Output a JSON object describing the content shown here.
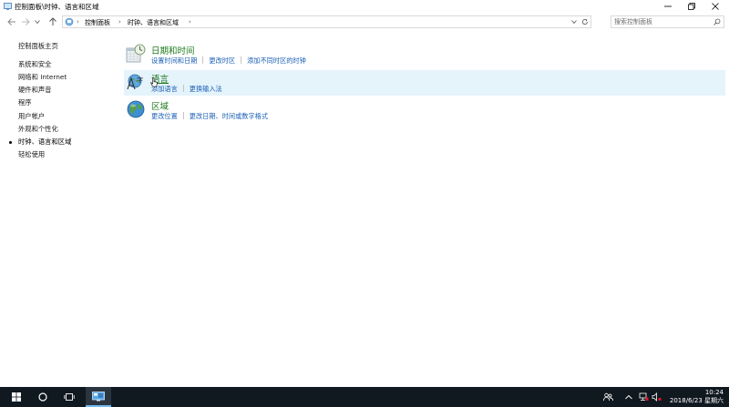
{
  "window": {
    "title": "控制面板\\时钟、语言和区域"
  },
  "address": {
    "crumbs": [
      "控制面板",
      "时钟、语言和区域"
    ],
    "search_placeholder": "搜索控制面板"
  },
  "sidebar": {
    "items": [
      {
        "label": "控制面板主页"
      },
      {
        "label": "系统和安全"
      },
      {
        "label": "网络和 Internet"
      },
      {
        "label": "硬件和声音"
      },
      {
        "label": "程序"
      },
      {
        "label": "用户帐户"
      },
      {
        "label": "外观和个性化"
      },
      {
        "label": "时钟、语言和区域",
        "current": true
      },
      {
        "label": "轻松使用"
      }
    ]
  },
  "categories": [
    {
      "title": "日期和时间",
      "icon": "date-time-icon",
      "links": [
        "设置时间和日期",
        "更改时区",
        "添加不同时区的时钟"
      ]
    },
    {
      "title": "语言",
      "icon": "language-icon",
      "links": [
        "添加语言",
        "更换输入法"
      ]
    },
    {
      "title": "区域",
      "icon": "region-globe-icon",
      "links": [
        "更改位置",
        "更改日期、时间或数字格式"
      ]
    }
  ],
  "taskbar": {
    "clock_time": "10:24",
    "clock_date": "2018/6/23 星期六",
    "ime_indicator": "",
    "tray_icons": [
      "people-icon",
      "chevron-up-icon",
      "network-icon",
      "volume-icon",
      "notification-icon"
    ]
  },
  "colors": {
    "link": "#1a5fb4",
    "category_title": "#1e7a1e",
    "highlight": "#e5f3fb",
    "taskbar": "#101820"
  }
}
